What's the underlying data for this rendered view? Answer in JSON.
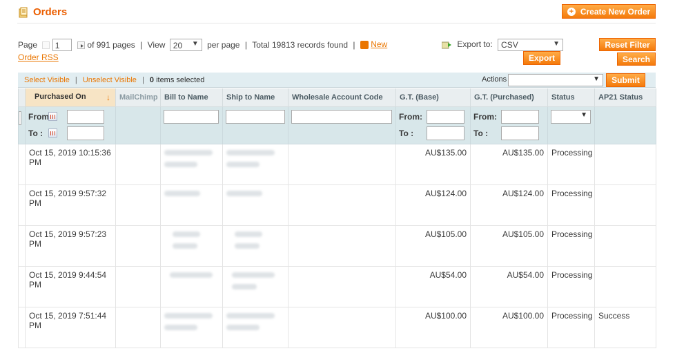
{
  "header": {
    "title": "Orders",
    "create_button": "Create New Order"
  },
  "pager": {
    "page_label": "Page",
    "page_value": "1",
    "of_pages": "of 991 pages",
    "view_label": "View",
    "per_page_value": "20",
    "per_page_label": "per page",
    "total": "Total 19813 records found",
    "rss_link": "New Order RSS",
    "rss_link_a": "New",
    "rss_link_b": "Order RSS"
  },
  "export": {
    "label": "Export to:",
    "format": "CSV",
    "button": "Export"
  },
  "actions": {
    "reset_filter": "Reset Filter",
    "search": "Search"
  },
  "massaction": {
    "select_visible": "Select Visible",
    "unselect_visible": "Unselect Visible",
    "items_selected_count": "0",
    "items_selected_label": "items selected",
    "actions_label": "Actions",
    "submit": "Submit"
  },
  "columns": [
    "Purchased On",
    "MailChimp",
    "Bill to Name",
    "Ship to Name",
    "Wholesale Account Code",
    "G.T. (Base)",
    "G.T. (Purchased)",
    "Status",
    "AP21 Status"
  ],
  "filters": {
    "from": "From:",
    "to": "To :"
  },
  "rows": [
    {
      "purchased_on": "Oct 15, 2019 10:15:36 PM",
      "gt_base": "AU$135.00",
      "gt_purchased": "AU$135.00",
      "status": "Processing",
      "ap21": ""
    },
    {
      "purchased_on": "Oct 15, 2019 9:57:32 PM",
      "gt_base": "AU$124.00",
      "gt_purchased": "AU$124.00",
      "status": "Processing",
      "ap21": ""
    },
    {
      "purchased_on": "Oct 15, 2019 9:57:23 PM",
      "gt_base": "AU$105.00",
      "gt_purchased": "AU$105.00",
      "status": "Processing",
      "ap21": ""
    },
    {
      "purchased_on": "Oct 15, 2019 9:44:54 PM",
      "gt_base": "AU$54.00",
      "gt_purchased": "AU$54.00",
      "status": "Processing",
      "ap21": ""
    },
    {
      "purchased_on": "Oct 15, 2019 7:51:44 PM",
      "gt_base": "AU$100.00",
      "gt_purchased": "AU$100.00",
      "status": "Processing",
      "ap21": "Success"
    }
  ],
  "colors": {
    "accent": "#eb5e00",
    "button": "#f47a0b",
    "header_bg": "#e9eef0",
    "filter_bg": "#d8e7ea"
  }
}
